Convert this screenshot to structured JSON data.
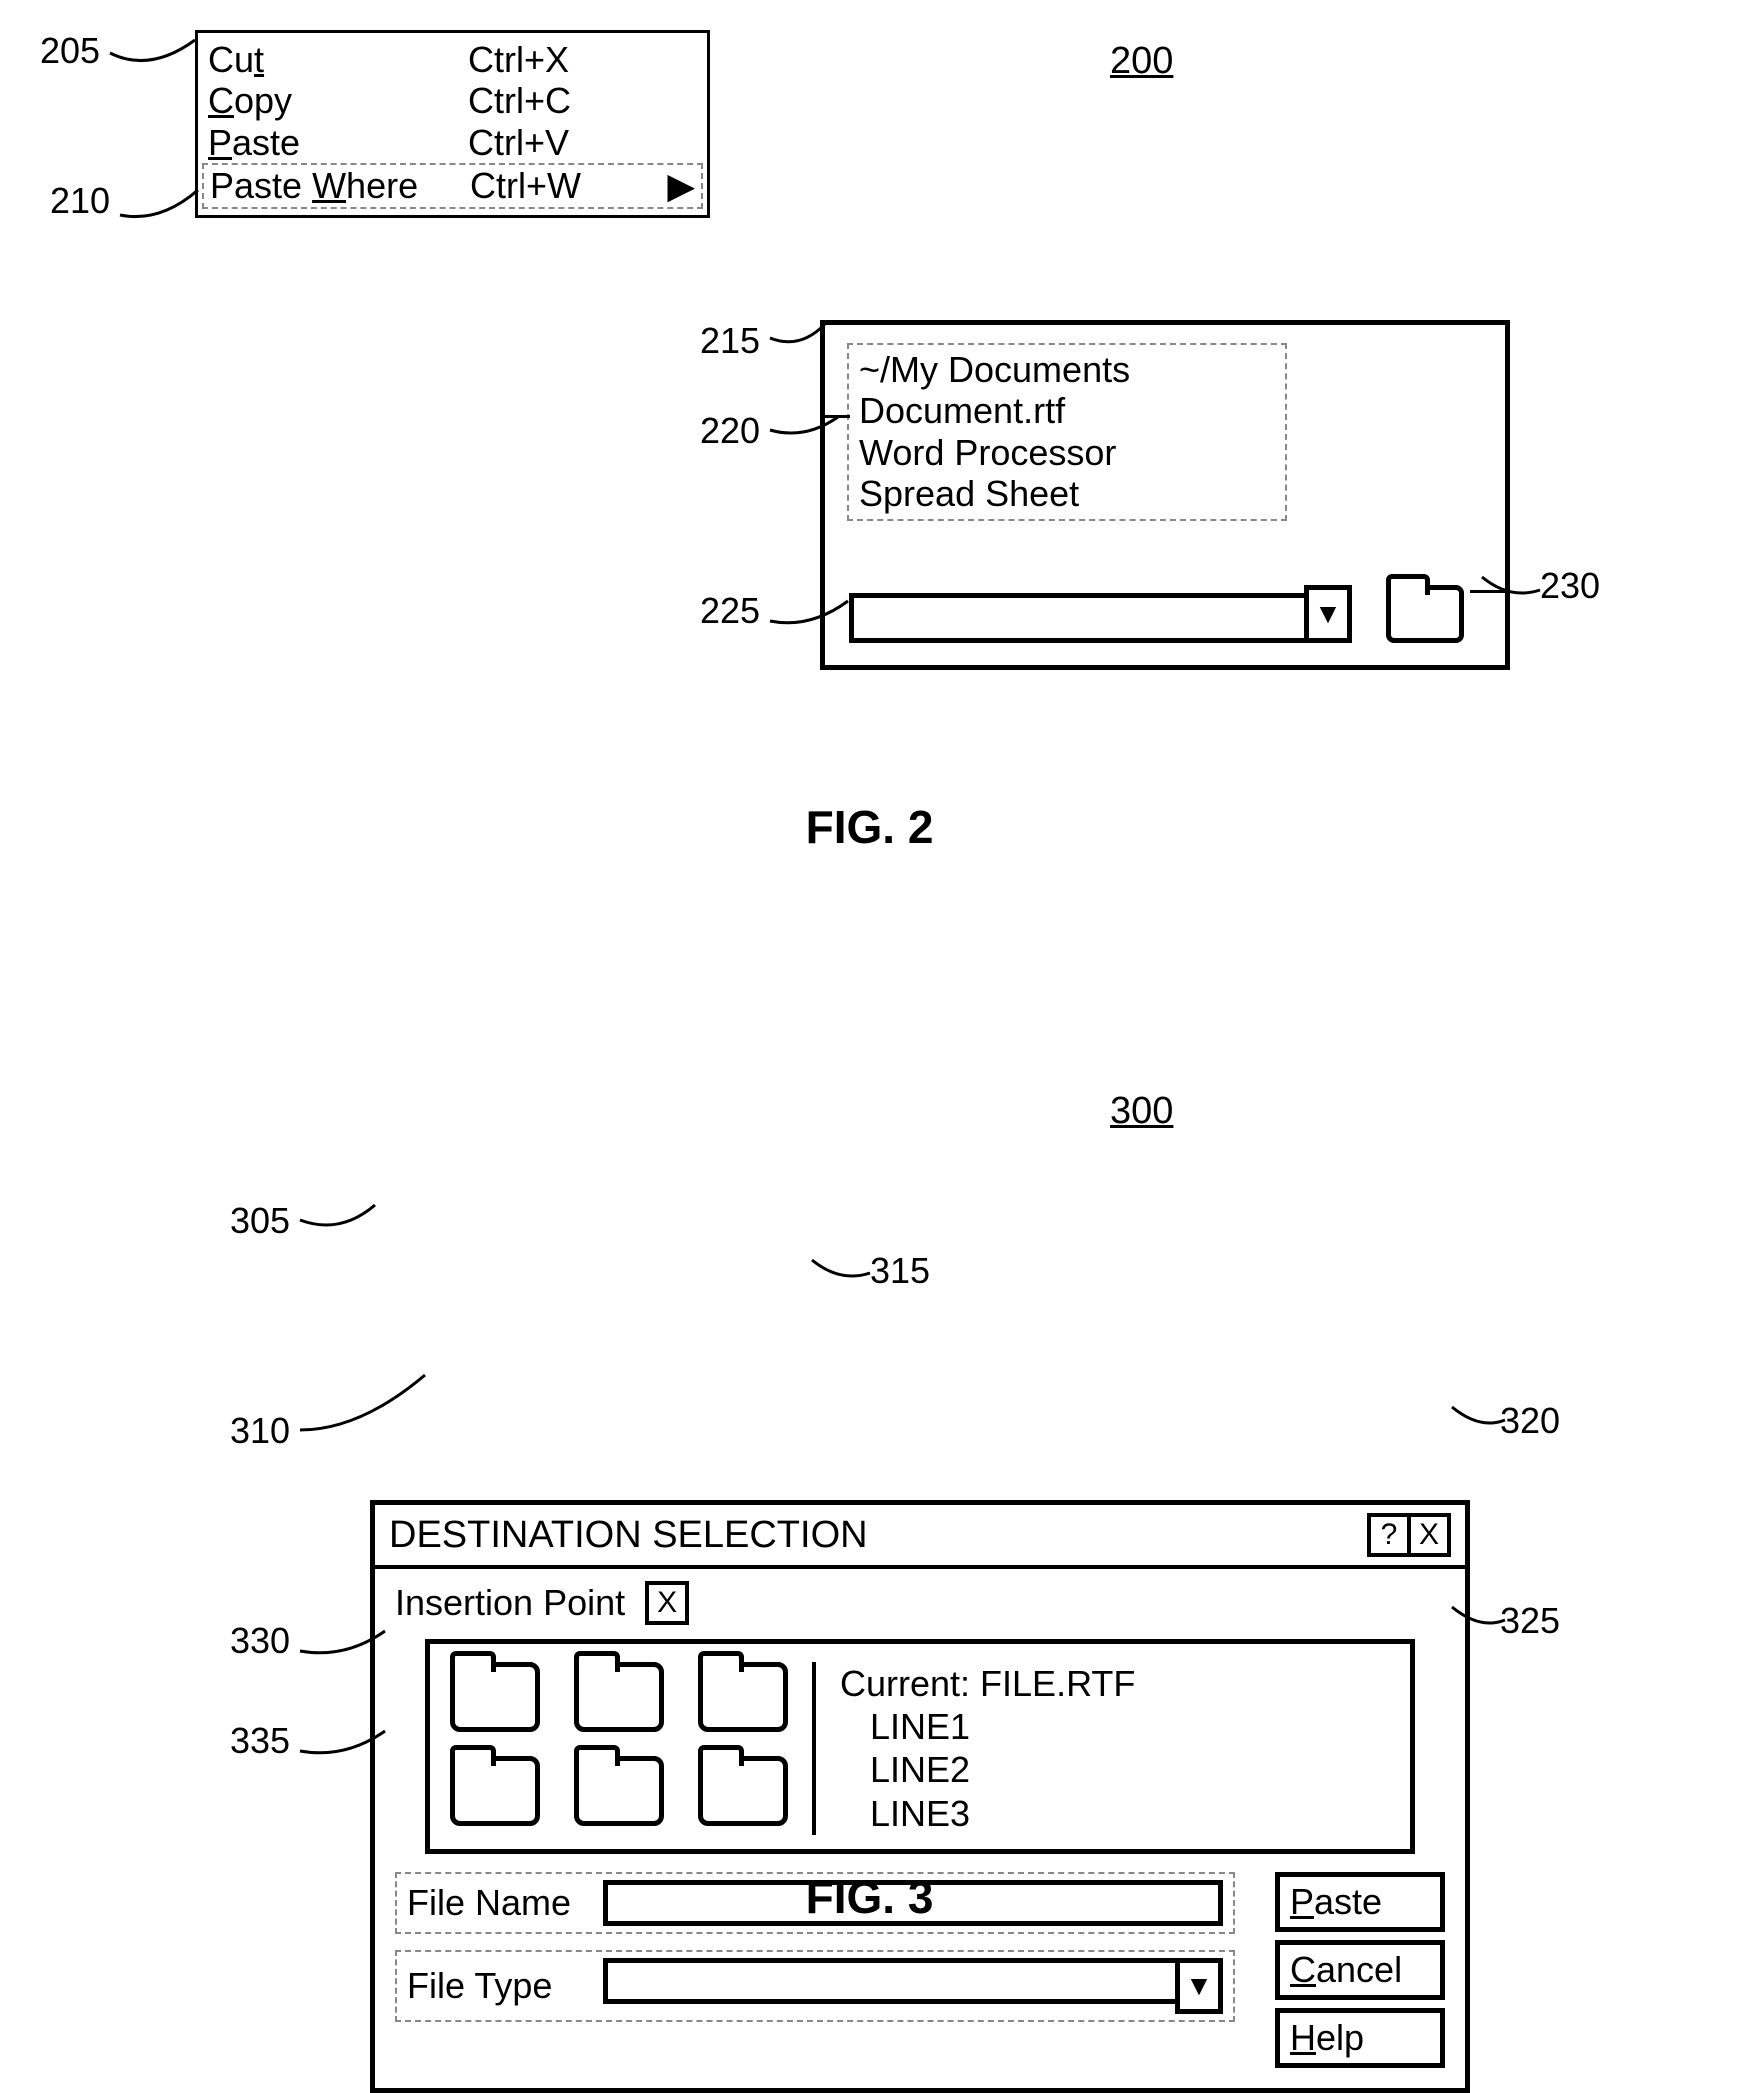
{
  "fig2": {
    "number_label": "200",
    "caption": "FIG. 2",
    "menu": {
      "callout_205": "205",
      "callout_210": "210",
      "items": [
        {
          "label_pre": "Cu",
          "label_u": "t",
          "label_post": "",
          "shortcut": "Ctrl+X",
          "has_arrow": false
        },
        {
          "label_pre": "",
          "label_u": "C",
          "label_post": "opy",
          "shortcut": "Ctrl+C",
          "has_arrow": false
        },
        {
          "label_pre": "",
          "label_u": "P",
          "label_post": "aste",
          "shortcut": "Ctrl+V",
          "has_arrow": false
        },
        {
          "label_pre": "Paste ",
          "label_u": "W",
          "label_post": "here",
          "shortcut": "Ctrl+W",
          "has_arrow": true
        }
      ],
      "arrow_glyph": "▶"
    },
    "submenu": {
      "callout_215": "215",
      "callout_220": "220",
      "callout_225": "225",
      "callout_230": "230",
      "list": [
        "~/My Documents",
        "Document.rtf",
        "Word Processor",
        "Spread Sheet"
      ],
      "dropdown_glyph": "▼"
    }
  },
  "fig3": {
    "number_label": "300",
    "caption": "FIG. 3",
    "dialog": {
      "title": "DESTINATION SELECTION",
      "help_glyph": "?",
      "close_glyph": "X",
      "insertion_label": "Insertion Point",
      "insertion_value": "X",
      "current_label": "Current: FILE.RTF",
      "lines": [
        "LINE1",
        "LINE2",
        "LINE3"
      ],
      "file_name_label": "File Name",
      "file_type_label": "File Type",
      "dropdown_glyph": "▼",
      "buttons": {
        "paste_pre": "",
        "paste_u": "P",
        "paste_post": "aste",
        "cancel_pre": "",
        "cancel_u": "C",
        "cancel_post": "ancel",
        "help_pre": "",
        "help_u": "H",
        "help_post": "elp"
      }
    },
    "callouts": {
      "c305": "305",
      "c310": "310",
      "c315": "315",
      "c320": "320",
      "c325": "325",
      "c330": "330",
      "c335": "335"
    }
  }
}
